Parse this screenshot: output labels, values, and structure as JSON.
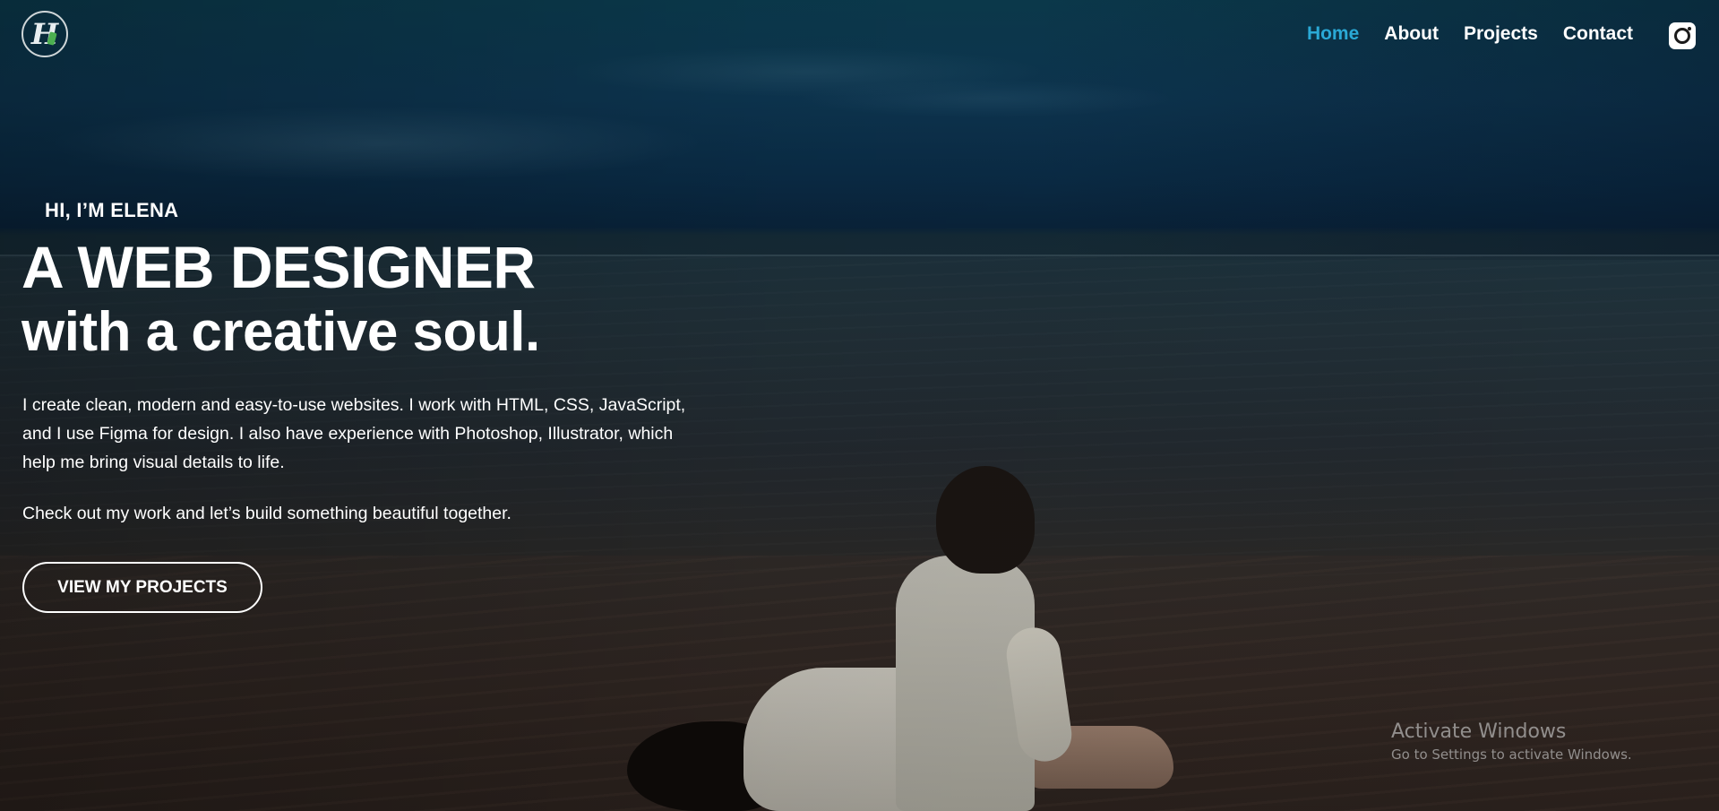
{
  "nav": {
    "logo_letter": "H",
    "items": [
      {
        "label": "Home",
        "active": true
      },
      {
        "label": "About",
        "active": false
      },
      {
        "label": "Projects",
        "active": false
      },
      {
        "label": "Contact",
        "active": false
      }
    ],
    "social_icon": "instagram-icon"
  },
  "hero": {
    "eyebrow": "HI, I’M ELENA",
    "headline_line1": "A WEB DESIGNER",
    "headline_line2": "with a creative soul.",
    "description": "I create clean, modern and easy-to-use websites. I work with HTML, CSS, JavaScript, and I use Figma for design. I also have experience with Photoshop, Illustrator, which help me bring visual details to life.",
    "description_2": "Check out my work and let’s build something beautiful together.",
    "cta_label": "VIEW MY PROJECTS"
  },
  "watermark": {
    "title": "Activate Windows",
    "subtitle": "Go to Settings to activate Windows."
  },
  "colors": {
    "accent": "#2aa9d6",
    "text": "#ffffff"
  }
}
